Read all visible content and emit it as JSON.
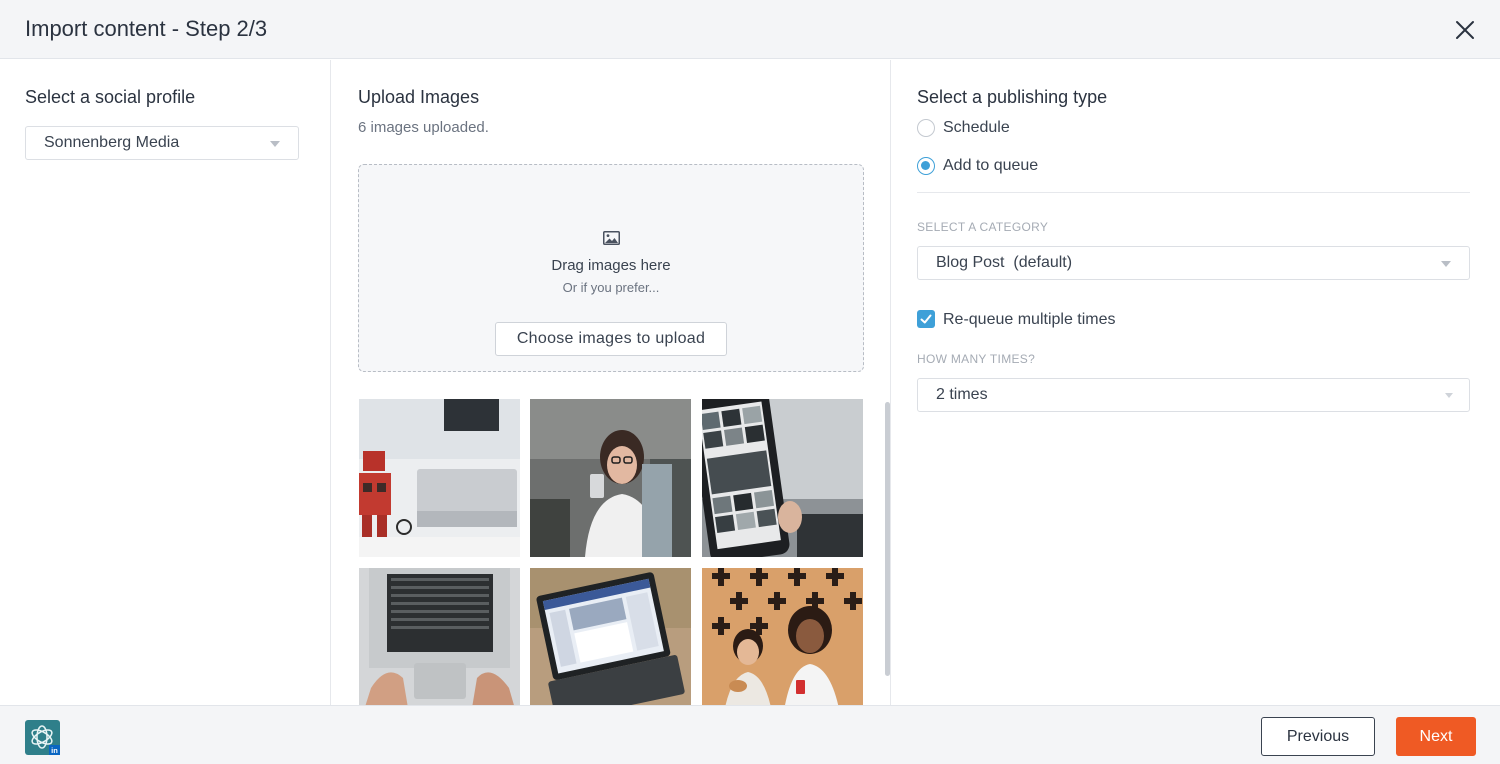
{
  "header": {
    "title": "Import content - Step 2/3",
    "close_icon": "close-icon"
  },
  "left": {
    "title": "Select a social profile",
    "profile_select": {
      "value": "Sonnenberg Media",
      "icon": "chevron-down-icon"
    }
  },
  "upload": {
    "title": "Upload Images",
    "status": "6 images uploaded.",
    "dropzone": {
      "icon": "image-icon",
      "main_text": "Drag images here",
      "sub_text": "Or if you prefer...",
      "button_label": "Choose images to upload"
    },
    "thumbnails": [
      {
        "name": "robot-laptop-desk"
      },
      {
        "name": "woman-phone-glasses"
      },
      {
        "name": "phone-instagram-grid"
      },
      {
        "name": "hands-typing-laptop"
      },
      {
        "name": "laptop-social-feed"
      },
      {
        "name": "two-women-phones"
      }
    ]
  },
  "publishing": {
    "title": "Select a publishing type",
    "options": [
      {
        "label": "Schedule",
        "selected": false
      },
      {
        "label": "Add to queue",
        "selected": true
      }
    ],
    "category": {
      "label": "SELECT A CATEGORY",
      "value": "Blog Post  (default)"
    },
    "requeue": {
      "label": "Re-queue multiple times",
      "checked": true
    },
    "times": {
      "label": "HOW MANY TIMES?",
      "value": "2 times"
    }
  },
  "footer": {
    "logo_icon": "app-logo-icon",
    "logo_badge": "in",
    "previous_label": "Previous",
    "next_label": "Next"
  },
  "colors": {
    "accent": "#3ea0d8",
    "primary_button": "#ef5a24",
    "header_bg": "#f4f5f7"
  }
}
